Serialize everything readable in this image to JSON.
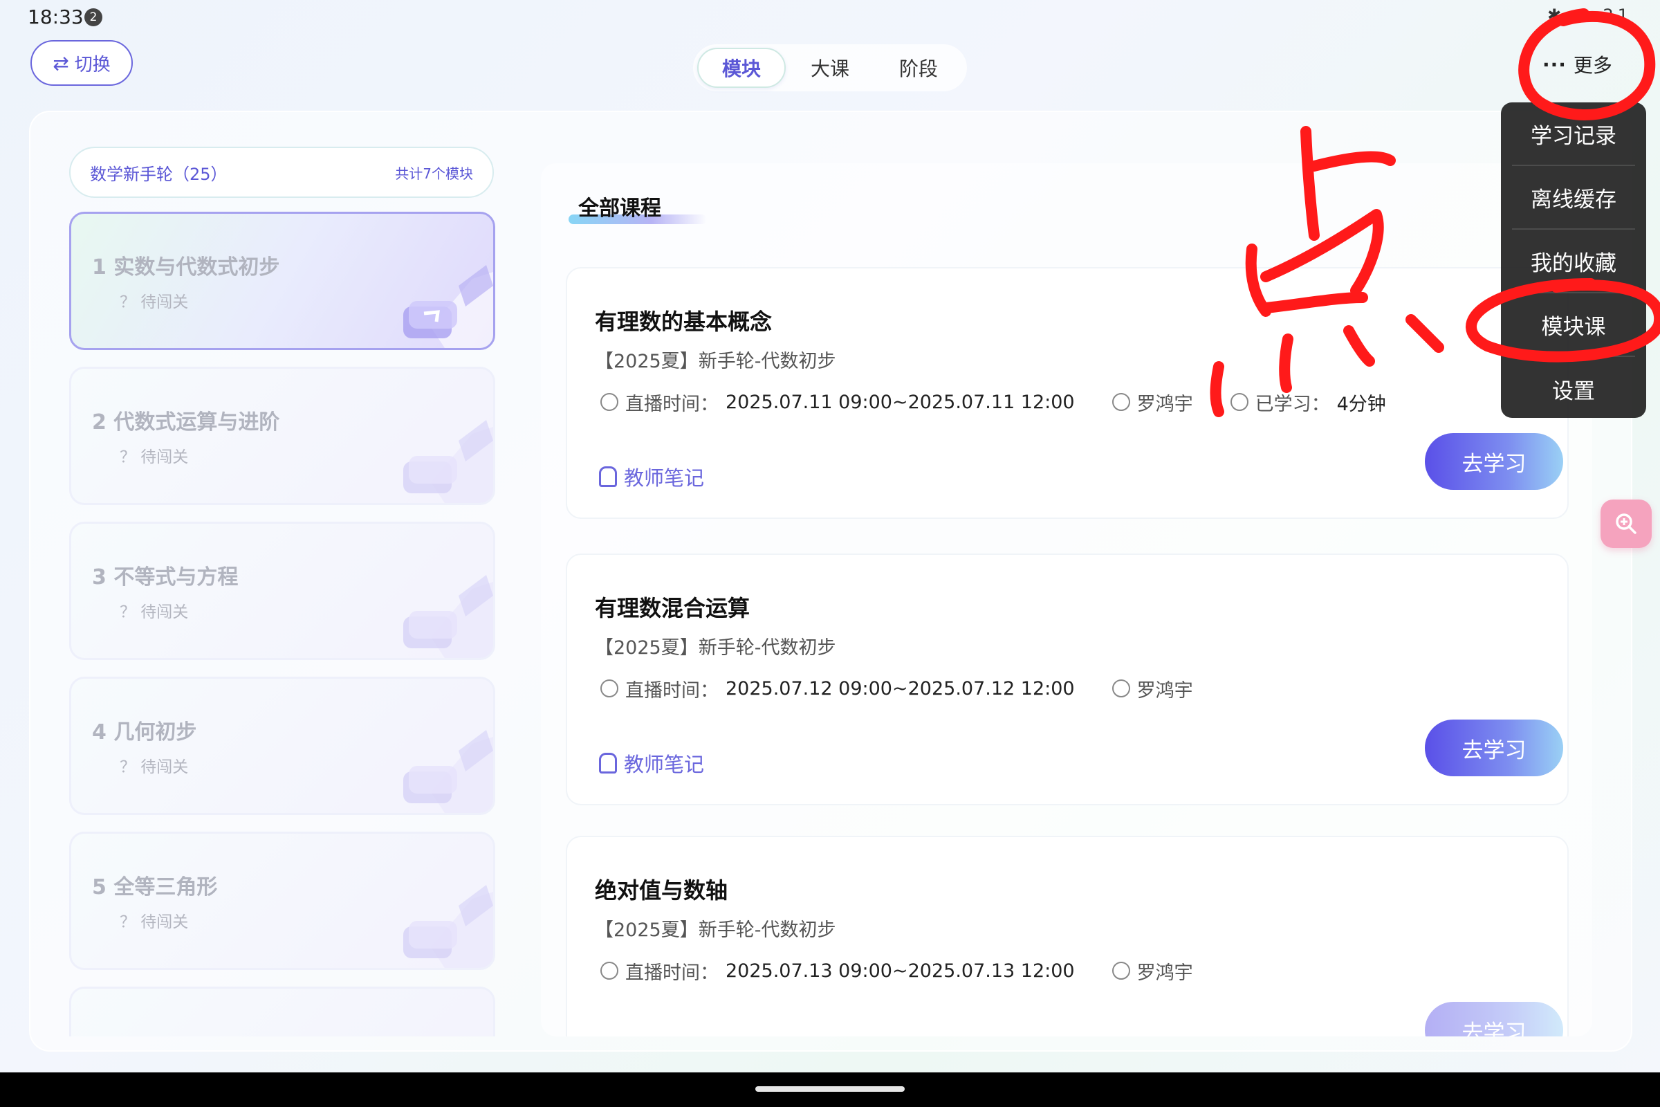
{
  "status_bar": {
    "time": "18:33",
    "notification_count": "2",
    "battery": "21"
  },
  "header": {
    "switch_label": "切换",
    "tabs": [
      {
        "label": "模块",
        "active": true
      },
      {
        "label": "大课",
        "active": false
      },
      {
        "label": "阶段",
        "active": false
      }
    ],
    "more_label": "更多"
  },
  "more_menu": {
    "items": [
      "学习记录",
      "离线缓存",
      "我的收藏",
      "模块课",
      "设置"
    ]
  },
  "sidebar": {
    "subject": "数学新手轮（25）",
    "module_total": "共计7个模块",
    "modules": [
      {
        "title": "1  实数与代数式初步",
        "status": "？ 待闯关",
        "active": true
      },
      {
        "title": "2  代数式运算与进阶",
        "status": "？ 待闯关",
        "active": false
      },
      {
        "title": "3  不等式与方程",
        "status": "？ 待闯关",
        "active": false
      },
      {
        "title": "4  几何初步",
        "status": "？ 待闯关",
        "active": false
      },
      {
        "title": "5  全等三角形",
        "status": "？ 待闯关",
        "active": false
      }
    ]
  },
  "main": {
    "section_title": "全部课程",
    "courses": [
      {
        "title": "有理数的基本概念",
        "subtitle": "【2025夏】新手轮-代数初步",
        "live_label": "直播时间：",
        "live_time": "2025.07.11 09:00~2025.07.11 12:00",
        "teacher": "罗鸿宇",
        "studied_label": "已学习：",
        "studied_value": "4分钟",
        "note_label": "教师笔记",
        "button_label": "去学习"
      },
      {
        "title": "有理数混合运算",
        "subtitle": "【2025夏】新手轮-代数初步",
        "live_label": "直播时间：",
        "live_time": "2025.07.12 09:00~2025.07.12 12:00",
        "teacher": "罗鸿宇",
        "note_label": "教师笔记",
        "button_label": "去学习"
      },
      {
        "title": "绝对值与数轴",
        "subtitle": "【2025夏】新手轮-代数初步",
        "live_label": "直播时间：",
        "live_time": "2025.07.13 09:00~2025.07.13 12:00",
        "teacher": "罗鸿宇",
        "button_label": "去学习"
      }
    ]
  },
  "annotation": {
    "handwritten_text": "点",
    "color": "#ff1a1a"
  },
  "colors": {
    "accent": "#5b57d6",
    "button_gradient_start": "#5a50e8",
    "button_gradient_end": "#9ad0f5",
    "float_button": "#f5a3be"
  }
}
